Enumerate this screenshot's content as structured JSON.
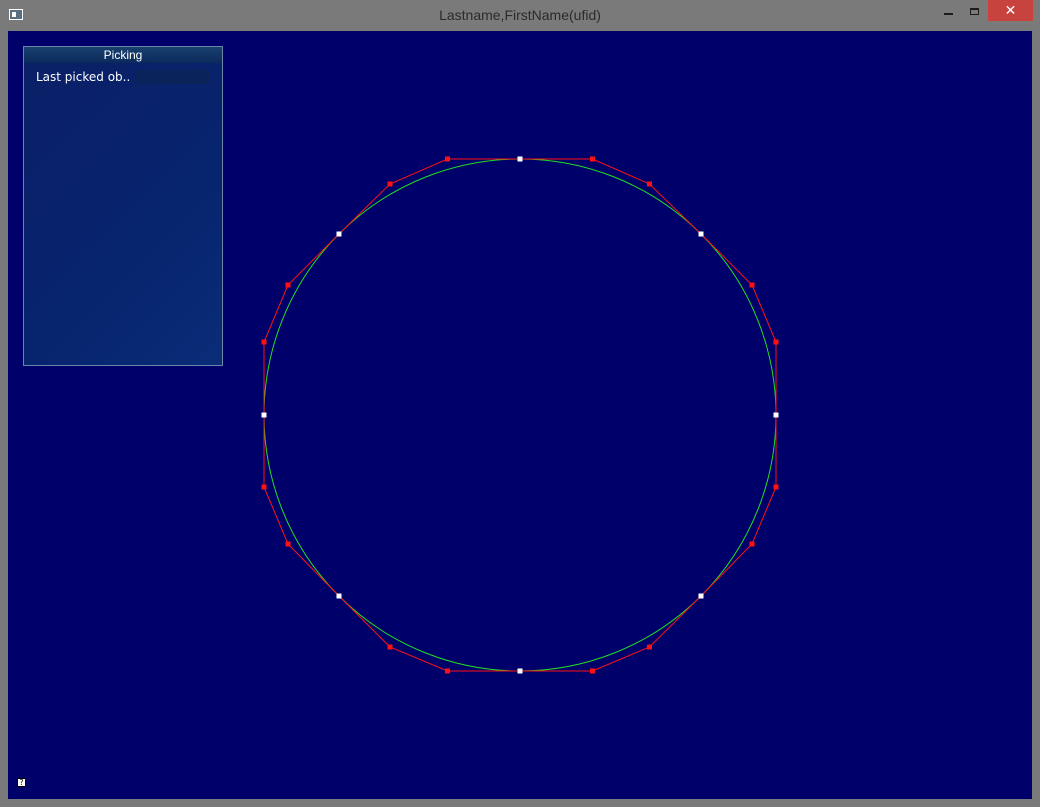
{
  "window": {
    "title": "Lastname,FirstName(ufid)",
    "close_glyph": "✕"
  },
  "picking_panel": {
    "header": "Picking",
    "label": "Last picked ob..",
    "value": ""
  },
  "help": {
    "glyph": "?"
  },
  "colors": {
    "viewport_background": "#00006a",
    "curve": "#22dd22",
    "control_polygon": "#ff1111",
    "control_point": "#ff1111",
    "on_curve_point": "#ffffff"
  }
}
